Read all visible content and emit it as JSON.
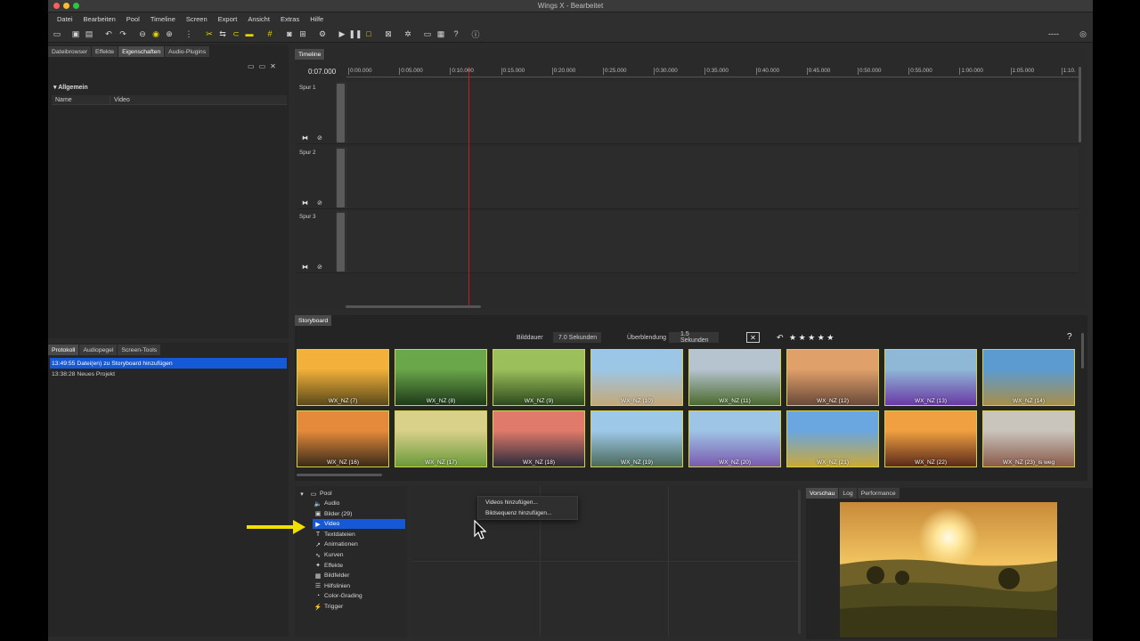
{
  "window": {
    "title": "Wings X - Bearbeitet"
  },
  "menu": [
    "Datei",
    "Bearbeiten",
    "Pool",
    "Timeline",
    "Screen",
    "Export",
    "Ansicht",
    "Extras",
    "Hilfe"
  ],
  "toolbar": {
    "right_text": "----"
  },
  "left_top": {
    "tabs": [
      "Dateibrowser",
      "Effekte",
      "Eigenschaften",
      "Audio-Plugins"
    ],
    "section": "Allgemein",
    "prop_key": "Name",
    "prop_value": "Video"
  },
  "left_bottom": {
    "tabs": [
      "Protokoll",
      "Audiopegel",
      "Screen-Tools"
    ],
    "log": [
      {
        "text": "13:49:55 Datei(en) zu Storyboard hinzufügen"
      },
      {
        "text": "13:38:28 Neues Projekt"
      }
    ]
  },
  "timeline": {
    "tab": "Timeline",
    "current_time": "0:07.000",
    "ruler": [
      "0:00.000",
      "0:05.000",
      "0:10.000",
      "0:15.000",
      "0:20.000",
      "0:25.000",
      "0:30.000",
      "0:35.000",
      "0:40.000",
      "0:45.000",
      "0:50.000",
      "0:55.000",
      "1:00.000",
      "1:05.000",
      "1:10."
    ],
    "tracks": [
      "Spur 1",
      "Spur 2",
      "Spur 3"
    ]
  },
  "storyboard": {
    "tab": "Storyboard",
    "image_duration_label": "Bilddauer",
    "image_duration_value": "7.0 Sekunden",
    "transition_label": "Überblendung",
    "transition_value": "1.5 Sekunden",
    "stars": "★ ★ ★ ★ ★",
    "help": "?",
    "thumbnails": [
      {
        "caption": "WX_NZ (7)",
        "c1": "#f3b03a",
        "c2": "#5a4a1a"
      },
      {
        "caption": "WX_NZ (8)",
        "c1": "#6aa64a",
        "c2": "#1f3a1a"
      },
      {
        "caption": "WX_NZ (9)",
        "c1": "#9bbf5a",
        "c2": "#2d4a1c"
      },
      {
        "caption": "WX_NZ (10)",
        "c1": "#9cc6e6",
        "c2": "#c4a878"
      },
      {
        "caption": "WX_NZ (11)",
        "c1": "#b6c4d0",
        "c2": "#4b6a2e"
      },
      {
        "caption": "WX_NZ (12)",
        "c1": "#e0a06a",
        "c2": "#6a4a3a"
      },
      {
        "caption": "WX_NZ (13)",
        "c1": "#8fb8d6",
        "c2": "#6a3aa6"
      },
      {
        "caption": "WX_NZ (14)",
        "c1": "#5c9bd0",
        "c2": "#a88e4a"
      },
      {
        "caption": "WX_NZ (16)",
        "c1": "#e58a3a",
        "c2": "#3a2a1a"
      },
      {
        "caption": "WX_NZ (17)",
        "c1": "#d9d08a",
        "c2": "#6a9a3a"
      },
      {
        "caption": "WX_NZ (18)",
        "c1": "#e07a6a",
        "c2": "#2a2a3a"
      },
      {
        "caption": "WX_NZ (19)",
        "c1": "#9ec8e8",
        "c2": "#4a6a5a"
      },
      {
        "caption": "WX_NZ (20)",
        "c1": "#9ec4e6",
        "c2": "#7a5ab0"
      },
      {
        "caption": "WX_NZ (21)",
        "c1": "#6aa6e0",
        "c2": "#caa83a"
      },
      {
        "caption": "WX_NZ (22)",
        "c1": "#f0a040",
        "c2": "#5a2a1a"
      },
      {
        "caption": "WX_NZ (23)_is weg",
        "c1": "#c9c4bc",
        "c2": "#8a5a4a"
      }
    ]
  },
  "pool": {
    "root": "Pool",
    "items": [
      {
        "label": "Audio",
        "icon": "🔈"
      },
      {
        "label": "Bilder (29)",
        "icon": "▣"
      },
      {
        "label": "Video",
        "icon": "▶"
      },
      {
        "label": "Textdateien",
        "icon": "T"
      },
      {
        "label": "Animationen",
        "icon": "↗"
      },
      {
        "label": "Kurven",
        "icon": "∿"
      },
      {
        "label": "Effekte",
        "icon": "✦"
      },
      {
        "label": "Bildfelder",
        "icon": "▦"
      },
      {
        "label": "Hilfslinien",
        "icon": "☰"
      },
      {
        "label": "Color-Grading",
        "icon": "◔"
      },
      {
        "label": "Trigger",
        "icon": "⚡"
      }
    ]
  },
  "context_menu": {
    "items": [
      "Videos hinzufügen...",
      "Bildsequenz hinzufügen..."
    ]
  },
  "preview": {
    "tabs": [
      "Vorschau",
      "Log",
      "Performance"
    ]
  },
  "colors": {
    "accent": "#1659d6",
    "thumb_border": "#d6d23c",
    "arrow": "#f2e000"
  }
}
